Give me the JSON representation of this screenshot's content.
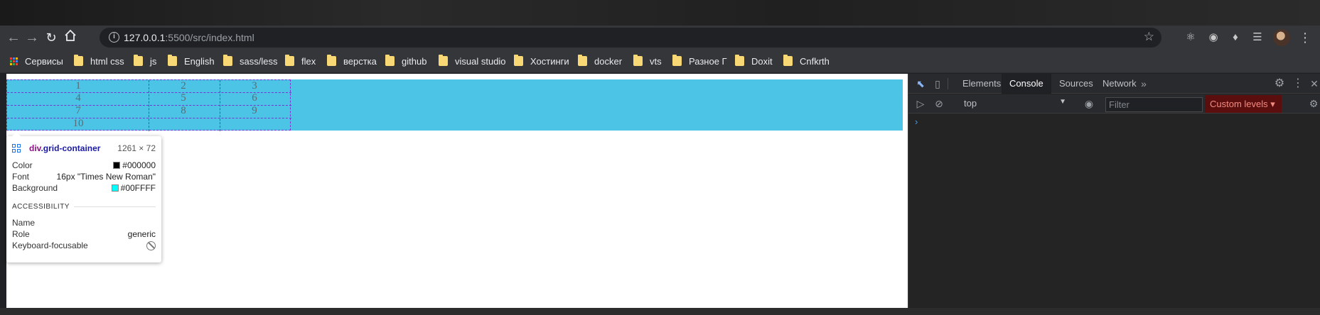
{
  "browser": {
    "url_host": "127.0.0.1",
    "url_rest": ":5500/src/index.html",
    "bookmarks": [
      {
        "label": "Сервисы",
        "type": "apps"
      },
      {
        "label": "html css",
        "type": "folder"
      },
      {
        "label": "js",
        "type": "folder"
      },
      {
        "label": "English",
        "type": "folder"
      },
      {
        "label": "sass/less",
        "type": "folder"
      },
      {
        "label": "flex",
        "type": "folder"
      },
      {
        "label": "верстка",
        "type": "folder"
      },
      {
        "label": "github",
        "type": "folder"
      },
      {
        "label": "visual studio",
        "type": "folder"
      },
      {
        "label": "Хостинги",
        "type": "folder"
      },
      {
        "label": "docker",
        "type": "folder"
      },
      {
        "label": "vts",
        "type": "folder"
      },
      {
        "label": "Разное Г",
        "type": "folder"
      },
      {
        "label": "Doxit",
        "type": "folder"
      },
      {
        "label": "Cnfkrth",
        "type": "folder"
      }
    ]
  },
  "page": {
    "grid_items": [
      "1",
      "2",
      "3",
      "4",
      "5",
      "6",
      "7",
      "8",
      "9",
      "10"
    ],
    "container_background": "#4bc4e6",
    "grid_line_color": "#7a35d1"
  },
  "tooltip": {
    "tag": "div",
    "class": ".grid-container",
    "size": "1261 × 72",
    "color_label": "Color",
    "color_value": "#000000",
    "font_label": "Font",
    "font_value": "16px \"Times New Roman\"",
    "background_label": "Background",
    "background_value": "#00FFFF",
    "accessibility_heading": "ACCESSIBILITY",
    "name_label": "Name",
    "name_value": "",
    "role_label": "Role",
    "role_value": "generic",
    "focusable_label": "Keyboard-focusable"
  },
  "devtools": {
    "tabs": [
      "Elements",
      "Console",
      "Sources",
      "Network"
    ],
    "active_tab": "Console",
    "context": "top",
    "filter_placeholder": "Filter",
    "levels": "Custom levels",
    "prompt": "›"
  }
}
